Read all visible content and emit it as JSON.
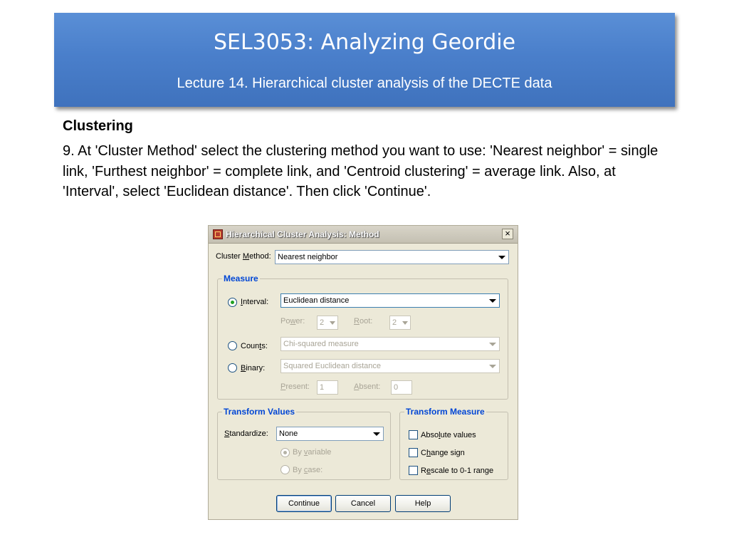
{
  "slide": {
    "title": "SEL3053: Analyzing Geordie",
    "subtitle": "Lecture 14. Hierarchical cluster analysis of the DECTE data",
    "heading": "Clustering",
    "paragraph": "9. At 'Cluster Method' select the clustering method you want to use: 'Nearest neighbor' = single link, 'Furthest neighbor' = complete link, and 'Centroid clustering' = average link. Also, at 'Interval', select 'Euclidean distance'. Then click 'Continue'."
  },
  "dialog": {
    "title": "Hierarchical Cluster Analysis: Method",
    "icon": "spss-app-icon",
    "close_label": "×",
    "cluster_method": {
      "label_pre": "Cluster ",
      "label_u": "M",
      "label_post": "ethod:",
      "value": "Nearest neighbor"
    },
    "measure": {
      "title": "Measure",
      "interval": {
        "label_pre": "",
        "label_u": "I",
        "label_post": "nterval:",
        "value": "Euclidean distance",
        "selected": true
      },
      "power": {
        "label_pre": "Po",
        "label_u": "w",
        "label_post": "er:",
        "value": "2"
      },
      "root": {
        "label_pre": "",
        "label_u": "R",
        "label_post": "oot:",
        "value": "2"
      },
      "counts": {
        "label_pre": "Coun",
        "label_u": "t",
        "label_post": "s:",
        "value": "Chi-squared measure",
        "selected": false
      },
      "binary": {
        "label_pre": "",
        "label_u": "B",
        "label_post": "inary:",
        "value": "Squared Euclidean distance",
        "selected": false
      },
      "present": {
        "label_pre": "",
        "label_u": "P",
        "label_post": "resent:",
        "value": "1"
      },
      "absent": {
        "label_pre": "",
        "label_u": "A",
        "label_post": "bsent:",
        "value": "0"
      }
    },
    "transform_values": {
      "title": "Transform Values",
      "standardize": {
        "label_pre": "",
        "label_u": "S",
        "label_post": "tandardize:",
        "value": "None"
      },
      "by_variable": {
        "label_pre": "By ",
        "label_u": "v",
        "label_post": "ariable",
        "selected": true
      },
      "by_case": {
        "label_pre": "By ",
        "label_u": "c",
        "label_post": "ase:",
        "selected": false
      }
    },
    "transform_measure": {
      "title": "Transform Measure",
      "absolute": {
        "label_pre": "Abso",
        "label_u": "l",
        "label_post": "ute values",
        "checked": false
      },
      "change_sign": {
        "label_pre": "C",
        "label_u": "h",
        "label_post": "ange sign",
        "checked": false
      },
      "rescale": {
        "label_pre": "R",
        "label_u": "e",
        "label_post": "scale to 0-1 range",
        "checked": false
      }
    },
    "buttons": {
      "continue": "Continue",
      "cancel": "Cancel",
      "help": "Help"
    }
  },
  "colors": {
    "banner": "#4a7fcb",
    "group_title": "#0046d5",
    "dialog_bg": "#ece9d8"
  }
}
